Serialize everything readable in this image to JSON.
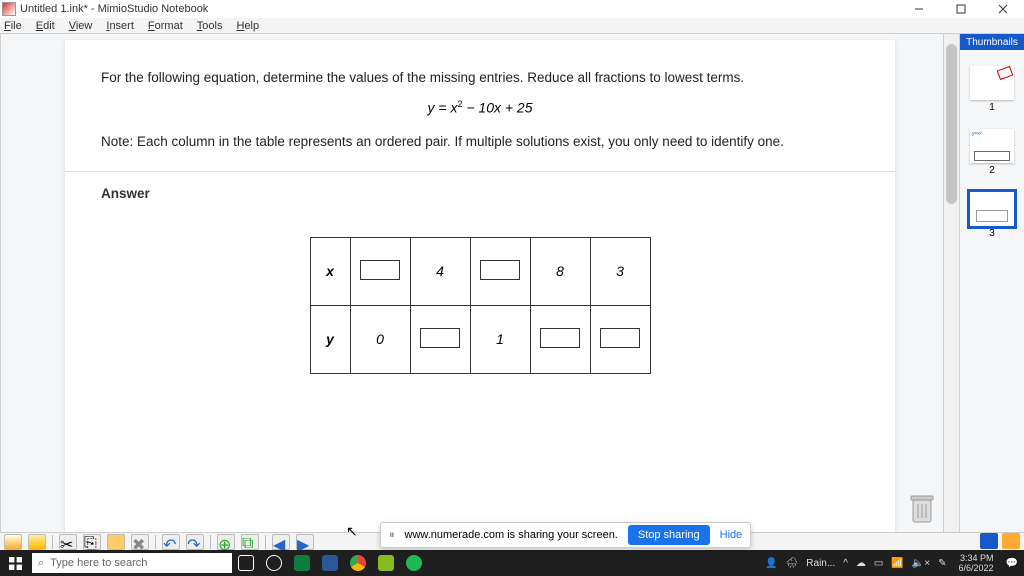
{
  "window": {
    "title": "Untitled 1.ink* - MimioStudio Notebook"
  },
  "menu": {
    "items": [
      "File",
      "Edit",
      "View",
      "Insert",
      "Format",
      "Tools",
      "Help"
    ]
  },
  "thumbnails": {
    "header": "Thumbnails",
    "pages": [
      "1",
      "2",
      "3"
    ],
    "selected": 2
  },
  "content": {
    "instruction": "For the following equation, determine the values of the missing entries. Reduce all fractions to lowest terms.",
    "equation_lhs": "y",
    "equation_rhs": " − 10x + 25",
    "equation_mid": "x",
    "note": "Note: Each column in the table represents an ordered pair. If multiple solutions exist, you only need to identify one.",
    "answer_label": "Answer",
    "table": {
      "row_x_label": "x",
      "row_y_label": "y",
      "x_cells": [
        "[box]",
        "4",
        "[box]",
        "8",
        "3"
      ],
      "y_cells": [
        "0",
        "[box]",
        "1",
        "[box]",
        "[box]"
      ]
    }
  },
  "share": {
    "message": "www.numerade.com is sharing your screen.",
    "stop": "Stop sharing",
    "hide": "Hide"
  },
  "taskbar": {
    "search_placeholder": "Type here to search",
    "weather": "Rain...",
    "time": "3:34 PM",
    "date": "6/6/2022"
  }
}
